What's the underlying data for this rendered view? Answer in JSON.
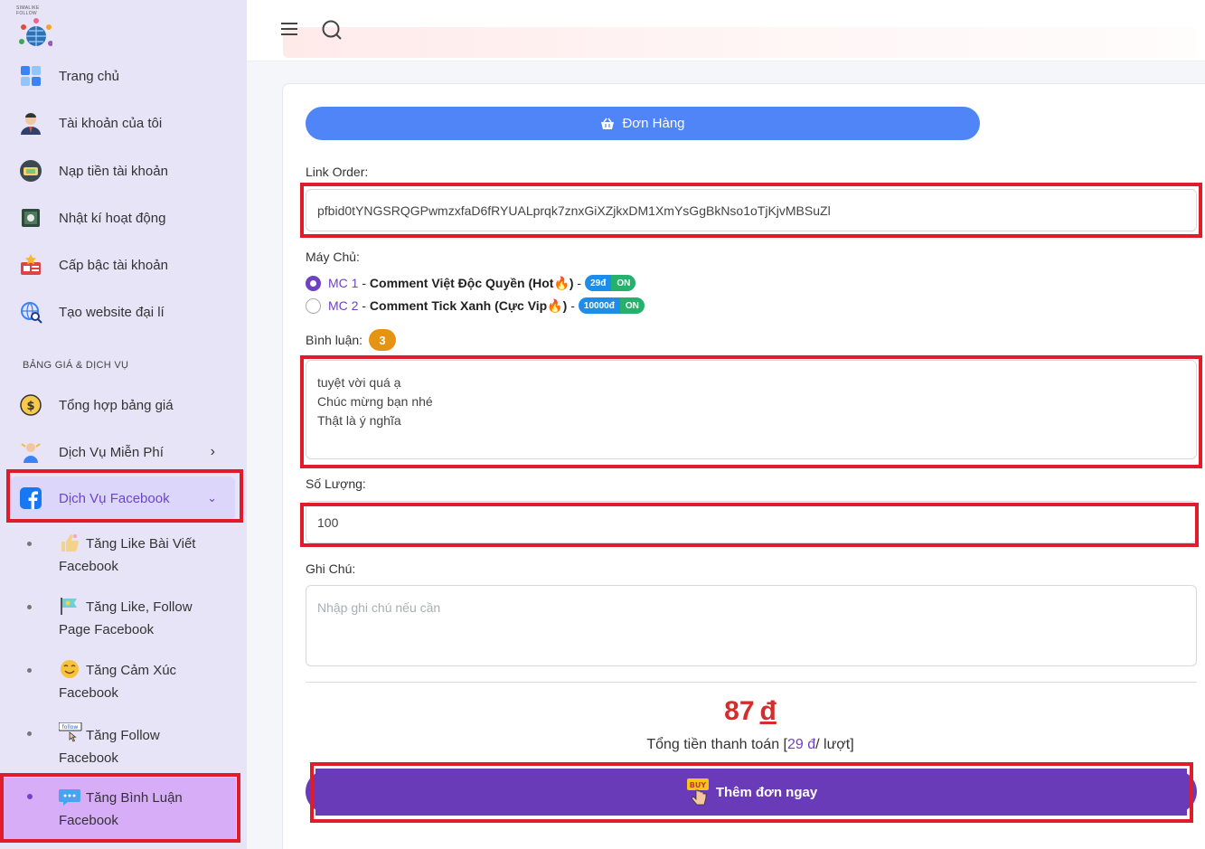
{
  "brand": {
    "logo_text": "SIMALIKE FOLLOW"
  },
  "topbar": {
    "menu_icon": "hamburger-icon",
    "search_icon": "search-icon"
  },
  "sidebar": {
    "main_items": [
      {
        "label": "Trang chủ",
        "icon": "dashboard-icon"
      },
      {
        "label": "Tài khoản của tôi",
        "icon": "user-icon"
      },
      {
        "label": "Nạp tiền tài khoản",
        "icon": "wallet-icon"
      },
      {
        "label": "Nhật kí hoạt động",
        "icon": "log-icon"
      },
      {
        "label": "Cấp bậc tài khoản",
        "icon": "rank-icon"
      },
      {
        "label": "Tạo website đại lí",
        "icon": "website-icon"
      }
    ],
    "section_title": "BẢNG GIÁ & DỊCH VỤ",
    "service_items": [
      {
        "label": "Tổng hợp bảng giá",
        "icon": "coin-icon"
      },
      {
        "label": "Dịch Vụ Miễn Phí",
        "icon": "free-icon"
      },
      {
        "label": "Dịch Vụ Facebook",
        "icon": "facebook-icon"
      }
    ],
    "facebook_sub": [
      {
        "line1": "Tăng Like Bài Viết",
        "line2": "Facebook"
      },
      {
        "line1": "Tăng Like, Follow",
        "line2": "Page Facebook"
      },
      {
        "line1": "Tăng Cảm Xúc",
        "line2": "Facebook"
      },
      {
        "line1": "Tăng Follow",
        "line2": "Facebook",
        "icon_text": "follow"
      },
      {
        "line1": "Tăng Bình Luận",
        "line2": "Facebook"
      }
    ]
  },
  "form": {
    "order_button": "Đơn Hàng",
    "link_label": "Link Order:",
    "link_value": "pfbid0tYNGSRQGPwmzxfaD6fRYUALprqk7znxGiXZjkxDM1XmYsGgBkNso1oTjKjvMBSuZl",
    "server_label": "Máy Chủ:",
    "servers": [
      {
        "code": "MC 1",
        "name": "Comment Việt Độc Quyền (Hot🔥)",
        "price": "29đ",
        "status": "ON",
        "selected": true
      },
      {
        "code": "MC 2",
        "name": "Comment Tick Xanh (Cực Vip🔥)",
        "price": "10000đ",
        "status": "ON",
        "selected": false
      }
    ],
    "comment_label": "Bình luận:",
    "comment_count": "3",
    "comments": [
      "tuyệt vời quá ạ",
      "Chúc mừng bạn nhé",
      "Thật là ý nghĩa"
    ],
    "quantity_label": "Số Lượng:",
    "quantity_value": "100",
    "note_label": "Ghi Chú:",
    "note_placeholder": "Nhập ghi chú nếu cần",
    "total_amount": "87",
    "currency": "đ",
    "total_prefix": "Tổng tiền thanh toán [",
    "unit_price": "29 đ",
    "total_suffix": "/ lượt]",
    "buy_button": "Thêm đơn ngay",
    "buy_icon_text": "BUY"
  },
  "colors": {
    "accent": "#6f42c1",
    "primary_button": "#4f85f6",
    "highlight": "#e01b2a",
    "sidebar_bg": "#e7e4f8"
  }
}
